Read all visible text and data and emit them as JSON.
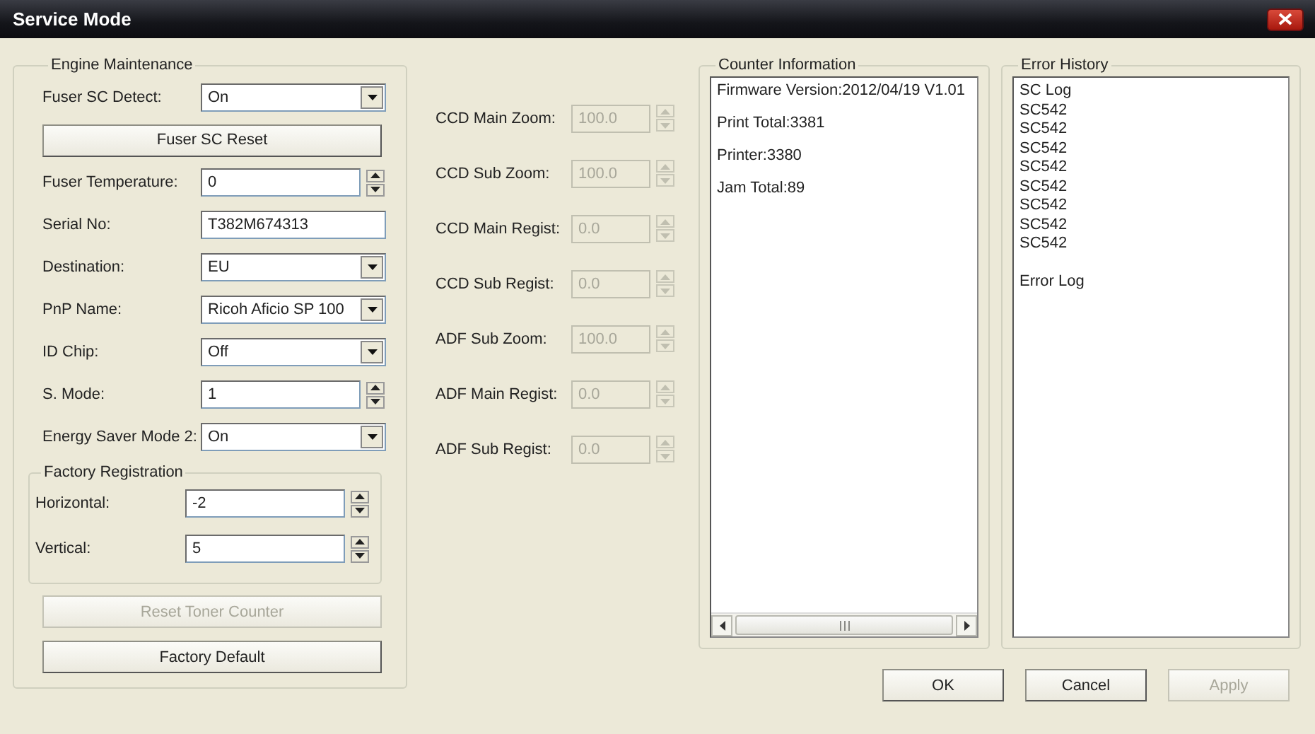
{
  "window": {
    "title": "Service Mode"
  },
  "engine_maintenance": {
    "title": "Engine Maintenance",
    "rows": [
      {
        "kind": "dropdown",
        "label": "Fuser SC Detect:",
        "value": "On"
      },
      {
        "kind": "button",
        "label": "Fuser SC Reset",
        "disabled": false
      },
      {
        "kind": "spinner",
        "label": "Fuser Temperature:",
        "value": "0"
      },
      {
        "kind": "text",
        "label": "Serial No:",
        "value": "T382M674313"
      },
      {
        "kind": "dropdown",
        "label": "Destination:",
        "value": "EU"
      },
      {
        "kind": "dropdown",
        "label": "PnP Name:",
        "value": "Ricoh Aficio SP 100"
      },
      {
        "kind": "dropdown",
        "label": "ID Chip:",
        "value": "Off"
      },
      {
        "kind": "spinner",
        "label": "S. Mode:",
        "value": "1"
      },
      {
        "kind": "dropdown",
        "label": "Energy Saver Mode 2:",
        "value": "On"
      }
    ],
    "factory_registration": {
      "title": "Factory Registration",
      "rows": [
        {
          "kind": "spinner",
          "label": "Horizontal:",
          "value": "-2"
        },
        {
          "kind": "spinner",
          "label": "Vertical:",
          "value": "5"
        }
      ]
    },
    "buttons": [
      {
        "label": "Reset Toner Counter",
        "disabled": true
      },
      {
        "label": "Factory Default",
        "disabled": false
      }
    ]
  },
  "scanner": [
    {
      "label": "CCD Main Zoom:",
      "value": "100.0",
      "disabled": true
    },
    {
      "label": "CCD Sub Zoom:",
      "value": "100.0",
      "disabled": true
    },
    {
      "label": "CCD Main Regist:",
      "value": "0.0",
      "disabled": true
    },
    {
      "label": "CCD Sub Regist:",
      "value": "0.0",
      "disabled": true
    },
    {
      "label": "ADF Sub Zoom:",
      "value": "100.0",
      "disabled": true
    },
    {
      "label": "ADF Main Regist:",
      "value": "0.0",
      "disabled": true
    },
    {
      "label": "ADF Sub Regist:",
      "value": "0.0",
      "disabled": true
    }
  ],
  "counter_information": {
    "title": "Counter Information",
    "lines": [
      "Firmware Version:2012/04/19 V1.01",
      "Print Total:3381",
      "Printer:3380",
      "Jam Total:89"
    ]
  },
  "error_history": {
    "title": "Error History",
    "sections": [
      {
        "lines": [
          "SC Log",
          "SC542",
          "SC542",
          "SC542",
          "SC542",
          "SC542",
          "SC542",
          "SC542",
          "SC542"
        ]
      },
      {
        "lines": [
          "Error Log"
        ]
      }
    ]
  },
  "buttons": [
    {
      "label": "OK",
      "disabled": false
    },
    {
      "label": "Cancel",
      "disabled": false
    },
    {
      "label": "Apply",
      "disabled": true
    }
  ]
}
